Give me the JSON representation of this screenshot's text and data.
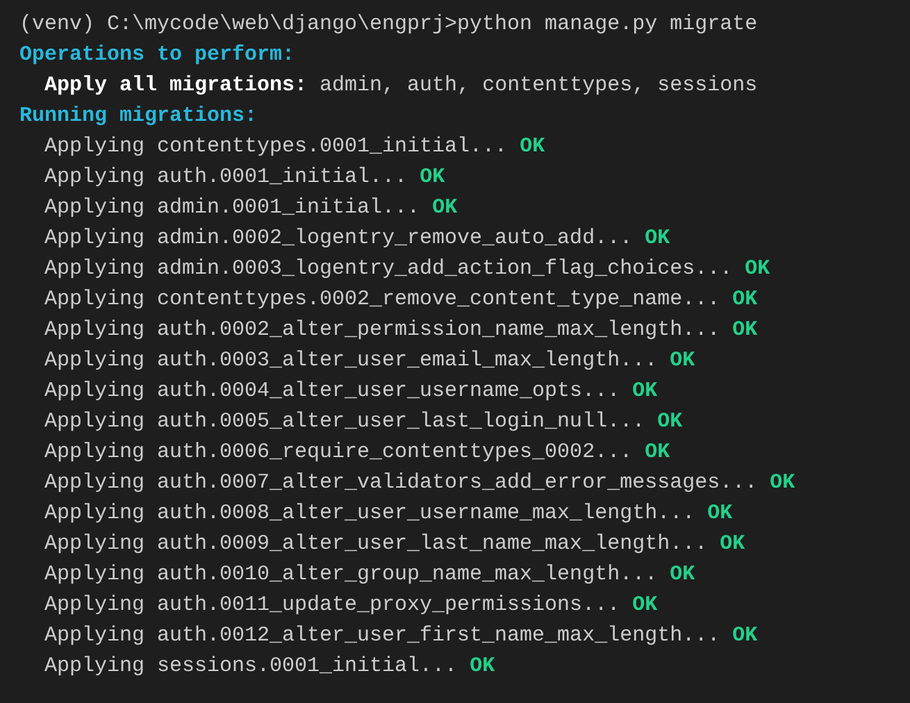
{
  "prompt": {
    "text": "(venv) C:\\mycode\\web\\django\\engprj>python manage.py migrate"
  },
  "operations": {
    "heading": "Operations to perform:",
    "label": "Apply all migrations:",
    "value": "admin, auth, contenttypes, sessions"
  },
  "running": {
    "heading": "Running migrations:",
    "migrations": [
      {
        "text": "Applying contenttypes.0001_initial...",
        "status": "OK"
      },
      {
        "text": "Applying auth.0001_initial...",
        "status": "OK"
      },
      {
        "text": "Applying admin.0001_initial...",
        "status": "OK"
      },
      {
        "text": "Applying admin.0002_logentry_remove_auto_add...",
        "status": "OK"
      },
      {
        "text": "Applying admin.0003_logentry_add_action_flag_choices...",
        "status": "OK"
      },
      {
        "text": "Applying contenttypes.0002_remove_content_type_name...",
        "status": "OK"
      },
      {
        "text": "Applying auth.0002_alter_permission_name_max_length...",
        "status": "OK"
      },
      {
        "text": "Applying auth.0003_alter_user_email_max_length...",
        "status": "OK"
      },
      {
        "text": "Applying auth.0004_alter_user_username_opts...",
        "status": "OK"
      },
      {
        "text": "Applying auth.0005_alter_user_last_login_null...",
        "status": "OK"
      },
      {
        "text": "Applying auth.0006_require_contenttypes_0002...",
        "status": "OK"
      },
      {
        "text": "Applying auth.0007_alter_validators_add_error_messages...",
        "status": "OK"
      },
      {
        "text": "Applying auth.0008_alter_user_username_max_length...",
        "status": "OK"
      },
      {
        "text": "Applying auth.0009_alter_user_last_name_max_length...",
        "status": "OK"
      },
      {
        "text": "Applying auth.0010_alter_group_name_max_length...",
        "status": "OK"
      },
      {
        "text": "Applying auth.0011_update_proxy_permissions...",
        "status": "OK"
      },
      {
        "text": "Applying auth.0012_alter_user_first_name_max_length...",
        "status": "OK"
      },
      {
        "text": "Applying sessions.0001_initial...",
        "status": "OK"
      }
    ]
  }
}
